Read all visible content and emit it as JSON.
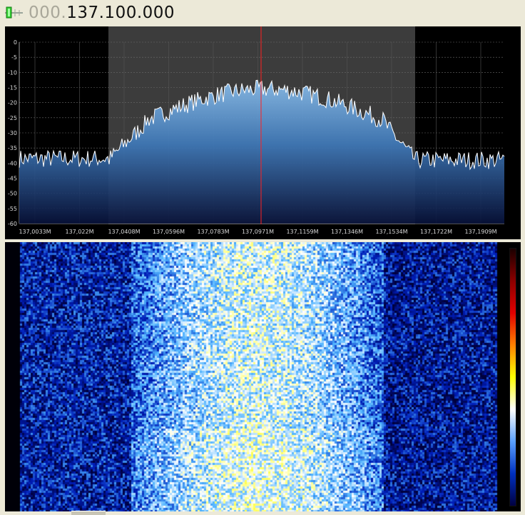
{
  "frequency": {
    "dim": "000.",
    "bright": "137.100.000",
    "icon": "tuner-slider-icon"
  },
  "spectrum": {
    "y_ticks": [
      "0",
      "-5",
      "-10",
      "-15",
      "-20",
      "-25",
      "-30",
      "-35",
      "-40",
      "-45",
      "-50",
      "-55",
      "-60"
    ],
    "x_ticks": [
      "137,0033M",
      "137,022M",
      "137,0408M",
      "137,0596M",
      "137,0783M",
      "137,0971M",
      "137,1159M",
      "137,1346M",
      "137,1534M",
      "137,1722M",
      "137,1909M"
    ],
    "colors": {
      "background": "#000000",
      "filter_band": "#3c3c3c",
      "trace": "#ffffff",
      "center_line": "#ff2020",
      "fill_top": "#7fb3e6",
      "fill_bottom": "#0a1540"
    }
  },
  "waterfall": {
    "colorbar_colors": [
      "#1a0000",
      "#8b0000",
      "#e00000",
      "#ff7f00",
      "#ffff00",
      "#ffffff",
      "#5aa0ff",
      "#0030c0",
      "#000040"
    ]
  }
}
